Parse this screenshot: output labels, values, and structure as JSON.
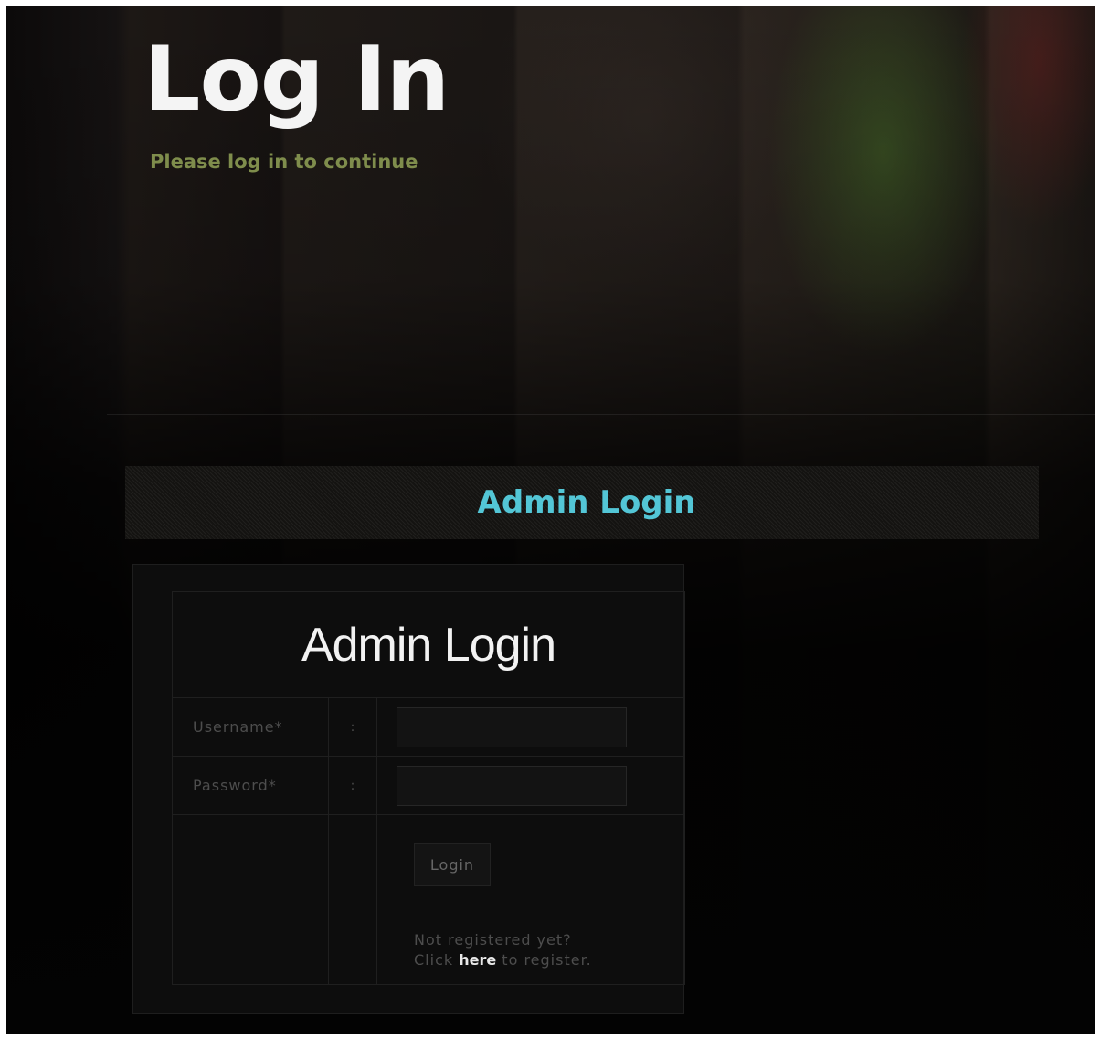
{
  "header": {
    "title": "Log In",
    "subtitle": "Please log in to continue"
  },
  "section": {
    "title": "Admin Login"
  },
  "form": {
    "heading": "Admin Login",
    "username_label": "Username*",
    "password_label": "Password*",
    "separator": ":",
    "username_value": "",
    "password_value": "",
    "login_button": "Login",
    "register_line1": "Not registered yet?",
    "register_prefix": "Click",
    "register_link": "here",
    "register_suffix": "to register."
  },
  "colors": {
    "title": "#f4f4f4",
    "subtitle": "#7f8d4c",
    "section_title": "#53c6d6",
    "label": "#4d4d4d"
  }
}
